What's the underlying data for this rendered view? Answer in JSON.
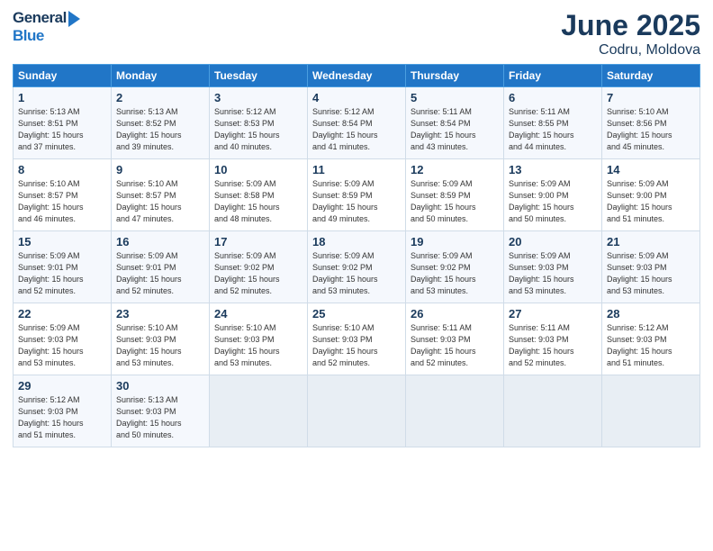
{
  "header": {
    "logo_general": "General",
    "logo_blue": "Blue",
    "title": "June 2025",
    "subtitle": "Codru, Moldova"
  },
  "weekdays": [
    "Sunday",
    "Monday",
    "Tuesday",
    "Wednesday",
    "Thursday",
    "Friday",
    "Saturday"
  ],
  "weeks": [
    [
      {
        "day": "1",
        "info": "Sunrise: 5:13 AM\nSunset: 8:51 PM\nDaylight: 15 hours\nand 37 minutes."
      },
      {
        "day": "2",
        "info": "Sunrise: 5:13 AM\nSunset: 8:52 PM\nDaylight: 15 hours\nand 39 minutes."
      },
      {
        "day": "3",
        "info": "Sunrise: 5:12 AM\nSunset: 8:53 PM\nDaylight: 15 hours\nand 40 minutes."
      },
      {
        "day": "4",
        "info": "Sunrise: 5:12 AM\nSunset: 8:54 PM\nDaylight: 15 hours\nand 41 minutes."
      },
      {
        "day": "5",
        "info": "Sunrise: 5:11 AM\nSunset: 8:54 PM\nDaylight: 15 hours\nand 43 minutes."
      },
      {
        "day": "6",
        "info": "Sunrise: 5:11 AM\nSunset: 8:55 PM\nDaylight: 15 hours\nand 44 minutes."
      },
      {
        "day": "7",
        "info": "Sunrise: 5:10 AM\nSunset: 8:56 PM\nDaylight: 15 hours\nand 45 minutes."
      }
    ],
    [
      {
        "day": "8",
        "info": "Sunrise: 5:10 AM\nSunset: 8:57 PM\nDaylight: 15 hours\nand 46 minutes."
      },
      {
        "day": "9",
        "info": "Sunrise: 5:10 AM\nSunset: 8:57 PM\nDaylight: 15 hours\nand 47 minutes."
      },
      {
        "day": "10",
        "info": "Sunrise: 5:09 AM\nSunset: 8:58 PM\nDaylight: 15 hours\nand 48 minutes."
      },
      {
        "day": "11",
        "info": "Sunrise: 5:09 AM\nSunset: 8:59 PM\nDaylight: 15 hours\nand 49 minutes."
      },
      {
        "day": "12",
        "info": "Sunrise: 5:09 AM\nSunset: 8:59 PM\nDaylight: 15 hours\nand 50 minutes."
      },
      {
        "day": "13",
        "info": "Sunrise: 5:09 AM\nSunset: 9:00 PM\nDaylight: 15 hours\nand 50 minutes."
      },
      {
        "day": "14",
        "info": "Sunrise: 5:09 AM\nSunset: 9:00 PM\nDaylight: 15 hours\nand 51 minutes."
      }
    ],
    [
      {
        "day": "15",
        "info": "Sunrise: 5:09 AM\nSunset: 9:01 PM\nDaylight: 15 hours\nand 52 minutes."
      },
      {
        "day": "16",
        "info": "Sunrise: 5:09 AM\nSunset: 9:01 PM\nDaylight: 15 hours\nand 52 minutes."
      },
      {
        "day": "17",
        "info": "Sunrise: 5:09 AM\nSunset: 9:02 PM\nDaylight: 15 hours\nand 52 minutes."
      },
      {
        "day": "18",
        "info": "Sunrise: 5:09 AM\nSunset: 9:02 PM\nDaylight: 15 hours\nand 53 minutes."
      },
      {
        "day": "19",
        "info": "Sunrise: 5:09 AM\nSunset: 9:02 PM\nDaylight: 15 hours\nand 53 minutes."
      },
      {
        "day": "20",
        "info": "Sunrise: 5:09 AM\nSunset: 9:03 PM\nDaylight: 15 hours\nand 53 minutes."
      },
      {
        "day": "21",
        "info": "Sunrise: 5:09 AM\nSunset: 9:03 PM\nDaylight: 15 hours\nand 53 minutes."
      }
    ],
    [
      {
        "day": "22",
        "info": "Sunrise: 5:09 AM\nSunset: 9:03 PM\nDaylight: 15 hours\nand 53 minutes."
      },
      {
        "day": "23",
        "info": "Sunrise: 5:10 AM\nSunset: 9:03 PM\nDaylight: 15 hours\nand 53 minutes."
      },
      {
        "day": "24",
        "info": "Sunrise: 5:10 AM\nSunset: 9:03 PM\nDaylight: 15 hours\nand 53 minutes."
      },
      {
        "day": "25",
        "info": "Sunrise: 5:10 AM\nSunset: 9:03 PM\nDaylight: 15 hours\nand 52 minutes."
      },
      {
        "day": "26",
        "info": "Sunrise: 5:11 AM\nSunset: 9:03 PM\nDaylight: 15 hours\nand 52 minutes."
      },
      {
        "day": "27",
        "info": "Sunrise: 5:11 AM\nSunset: 9:03 PM\nDaylight: 15 hours\nand 52 minutes."
      },
      {
        "day": "28",
        "info": "Sunrise: 5:12 AM\nSunset: 9:03 PM\nDaylight: 15 hours\nand 51 minutes."
      }
    ],
    [
      {
        "day": "29",
        "info": "Sunrise: 5:12 AM\nSunset: 9:03 PM\nDaylight: 15 hours\nand 51 minutes."
      },
      {
        "day": "30",
        "info": "Sunrise: 5:13 AM\nSunset: 9:03 PM\nDaylight: 15 hours\nand 50 minutes."
      },
      {
        "day": "",
        "info": ""
      },
      {
        "day": "",
        "info": ""
      },
      {
        "day": "",
        "info": ""
      },
      {
        "day": "",
        "info": ""
      },
      {
        "day": "",
        "info": ""
      }
    ]
  ]
}
